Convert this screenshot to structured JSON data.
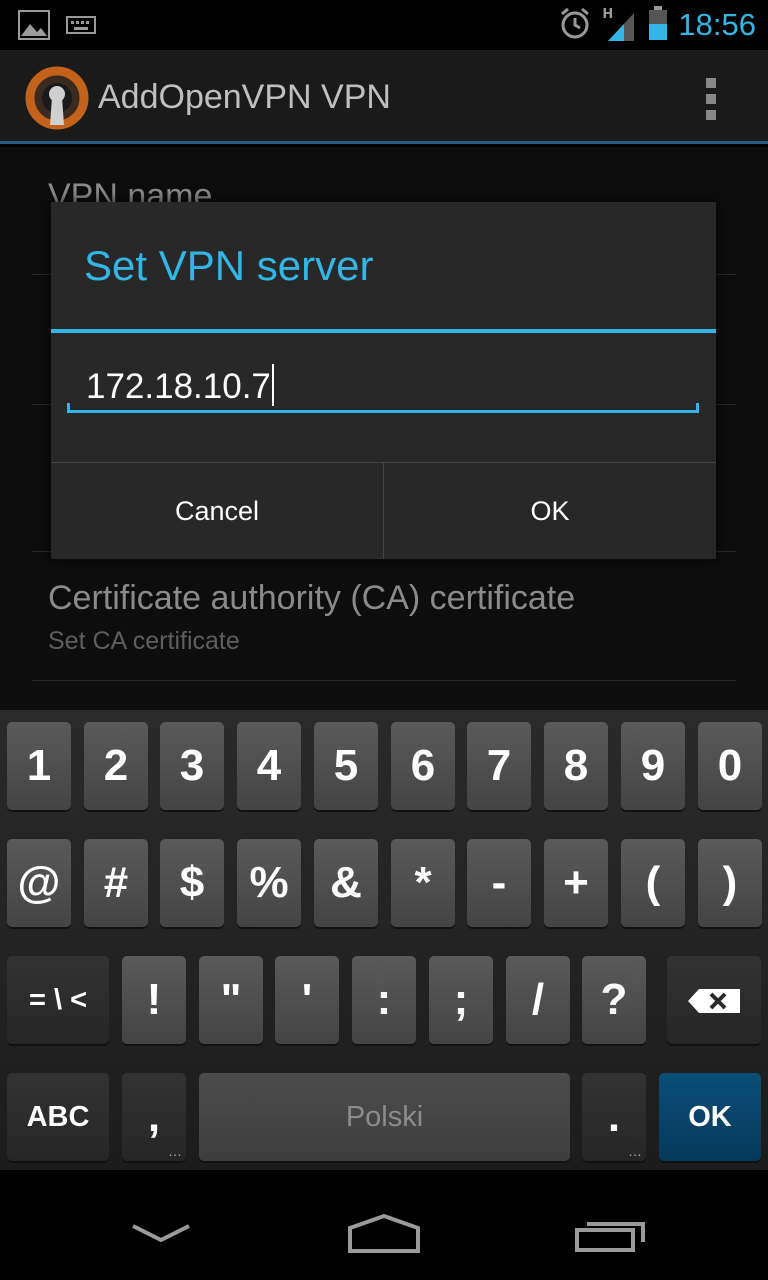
{
  "status_bar": {
    "left_icons": [
      "image-icon",
      "keyboard-icon"
    ],
    "right_icons": [
      "alarm-icon",
      "signal-icon",
      "battery-icon"
    ],
    "network_type": "H",
    "time": "18:56"
  },
  "action_bar": {
    "title": "AddOpenVPN VPN",
    "logo_icon": "openvpn-logo-icon",
    "menu_icon": "overflow-menu-icon"
  },
  "settings_list": {
    "items": [
      {
        "title": "VPN name",
        "subtitle": ""
      },
      {
        "title": "Certificate authority (CA) certificate",
        "subtitle": "Set CA certificate"
      }
    ]
  },
  "dialog": {
    "title": "Set VPN server",
    "input_value": "172.18.10.7",
    "cancel_label": "Cancel",
    "ok_label": "OK"
  },
  "keyboard": {
    "row1": [
      "1",
      "2",
      "3",
      "4",
      "5",
      "6",
      "7",
      "8",
      "9",
      "0"
    ],
    "row2": [
      "@",
      "#",
      "$",
      "%",
      "&",
      "*",
      "-",
      "+",
      "(",
      ")"
    ],
    "row3_mode": "= \\ <",
    "row3": [
      "!",
      "\"",
      "'",
      ":",
      ";",
      "/",
      "?"
    ],
    "backspace_icon": "backspace-icon",
    "row4_mode": "ABC",
    "comma": ",",
    "space_label": "Polski",
    "period": ".",
    "enter_label": "OK",
    "accent": "#0a4e78"
  },
  "nav_bar": {
    "back_icon": "back-icon",
    "home_icon": "home-icon",
    "recents_icon": "recent-apps-icon"
  },
  "colors": {
    "holo_blue": "#33b5e5",
    "dialog_bg": "#282828"
  }
}
